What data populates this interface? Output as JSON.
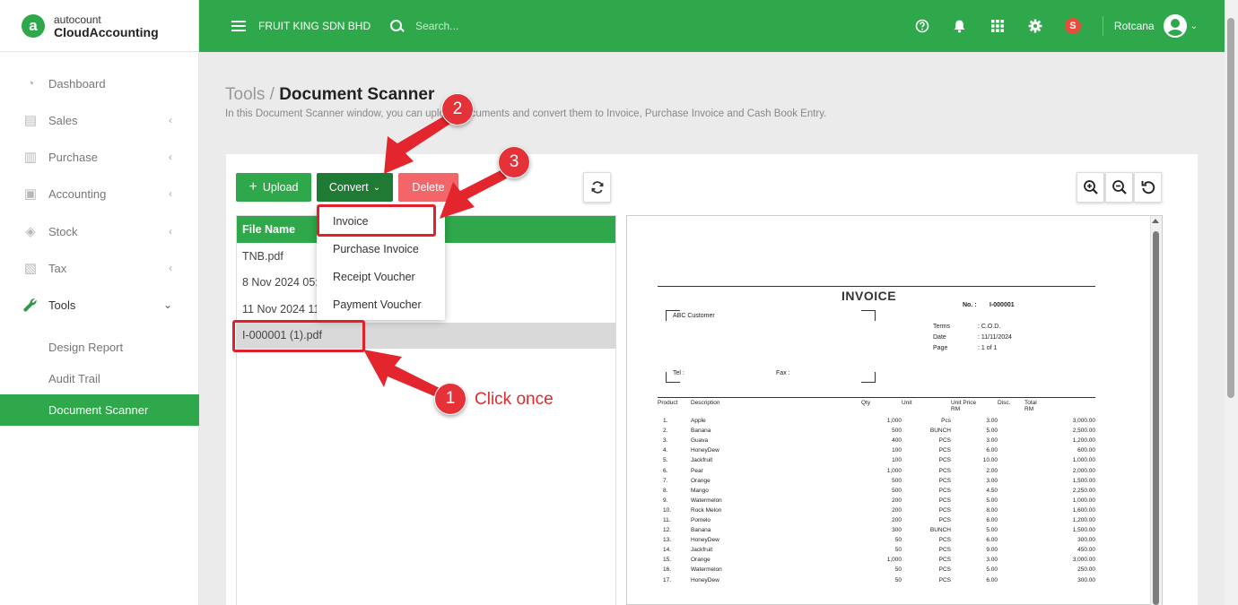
{
  "brand": {
    "line1": "autocount",
    "line2": "CloudAccounting",
    "logo_letter": "a"
  },
  "topbar": {
    "company": "FRUIT KING SDN BHD",
    "search_placeholder": "Search...",
    "user": "Rotcana",
    "badge": "S"
  },
  "sidebar": {
    "items": [
      {
        "label": "Dashboard",
        "icon": "dashboard-icon"
      },
      {
        "label": "Sales",
        "icon": "sales-icon"
      },
      {
        "label": "Purchase",
        "icon": "purchase-icon"
      },
      {
        "label": "Accounting",
        "icon": "accounting-icon"
      },
      {
        "label": "Stock",
        "icon": "stock-icon"
      },
      {
        "label": "Tax",
        "icon": "tax-icon"
      },
      {
        "label": "Tools",
        "icon": "wrench-icon"
      }
    ],
    "tools_sub": [
      "Design Report",
      "Audit Trail",
      "Document Scanner"
    ]
  },
  "page": {
    "crumb": "Tools",
    "sep": " / ",
    "title": "Document Scanner",
    "desc": "In this Document Scanner window, you can upload documents and convert them to Invoice, Purchase Invoice and Cash Book Entry."
  },
  "toolbar": {
    "upload": "Upload",
    "convert": "Convert",
    "delete": "Delete"
  },
  "files": {
    "header": "File Name",
    "rows": [
      "TNB.pdf",
      "8 Nov 2024 05:3",
      "11 Nov 2024 11",
      "I-000001 (1).pdf"
    ]
  },
  "convert_menu": [
    "Invoice",
    "Purchase Invoice",
    "Receipt Voucher",
    "Payment Voucher"
  ],
  "annotations": {
    "m1": "1",
    "m2": "2",
    "m3": "3",
    "click_text": "Click once"
  },
  "invoice": {
    "title": "INVOICE",
    "no_label": "No.  :",
    "no": "I-000001",
    "customer": "ABC Customer",
    "terms_label": "Terms",
    "terms": ":  C.O.D.",
    "date_label": "Date",
    "date": ":  11/11/2024",
    "page_label": "Page",
    "page": ":  1 of 1",
    "tel": "Tel  :",
    "fax": "Fax  :",
    "headers": [
      "Product",
      "Description",
      "Qty",
      "Unit",
      "Unit Price",
      "Disc.",
      "Total"
    ],
    "rm": "RM",
    "lines": [
      [
        "1.",
        "Apple",
        "1,000",
        "Pcs",
        "3.00",
        "3,000.00"
      ],
      [
        "2.",
        "Banana",
        "500",
        "BUNCH",
        "5.00",
        "2,500.00"
      ],
      [
        "3.",
        "Guava",
        "400",
        "PCS",
        "3.00",
        "1,200.00"
      ],
      [
        "4.",
        "HoneyDew",
        "100",
        "PCS",
        "6.00",
        "600.00"
      ],
      [
        "5.",
        "Jackfruit",
        "100",
        "PCS",
        "10.00",
        "1,000.00"
      ],
      [
        "6.",
        "Pear",
        "1,000",
        "PCS",
        "2.00",
        "2,000.00"
      ],
      [
        "7.",
        "Orange",
        "500",
        "PCS",
        "3.00",
        "1,500.00"
      ],
      [
        "8.",
        "Mango",
        "500",
        "PCS",
        "4.50",
        "2,250.00"
      ],
      [
        "9.",
        "Watermelon",
        "200",
        "PCS",
        "5.00",
        "1,000.00"
      ],
      [
        "10.",
        "Rock Melon",
        "200",
        "PCS",
        "8.00",
        "1,600.00"
      ],
      [
        "11.",
        "Pomelo",
        "200",
        "PCS",
        "6.00",
        "1,200.00"
      ],
      [
        "12.",
        "Banana",
        "300",
        "BUNCH",
        "5.00",
        "1,500.00"
      ],
      [
        "13.",
        "HoneyDew",
        "50",
        "PCS",
        "6.00",
        "300.00"
      ],
      [
        "14.",
        "Jackfruit",
        "50",
        "PCS",
        "9.00",
        "450.00"
      ],
      [
        "15.",
        "Orange",
        "1,000",
        "PCS",
        "3.00",
        "3,000.00"
      ],
      [
        "16.",
        "Watermelon",
        "50",
        "PCS",
        "5.00",
        "250.00"
      ],
      [
        "17.",
        "HoneyDew",
        "50",
        "PCS",
        "6.00",
        "300.00"
      ]
    ]
  },
  "colors": {
    "brand_green": "#2ea84a",
    "convert_green": "#1f7a34",
    "delete_red": "#f2666a",
    "annotation_red": "#e0202a"
  }
}
